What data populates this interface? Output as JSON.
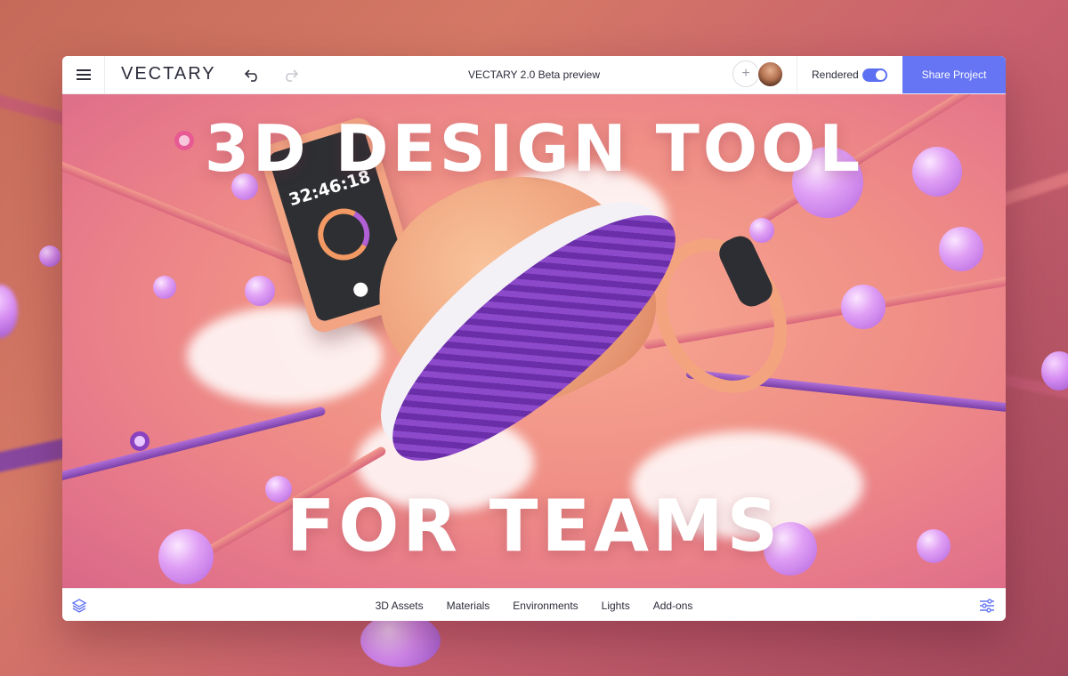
{
  "app": {
    "logo": "VECTARY",
    "title": "VECTARY 2.0 Beta preview"
  },
  "topbar": {
    "rendered_label": "Rendered",
    "rendered_on": true,
    "share_label": "Share Project",
    "add_user_symbol": "+"
  },
  "canvas": {
    "headline_top": "3D DESIGN TOOL",
    "headline_bottom": "FOR TEAMS",
    "phone_time": "32:46:18"
  },
  "bottombar": {
    "tabs": [
      "3D Assets",
      "Materials",
      "Environments",
      "Lights",
      "Add-ons"
    ]
  },
  "colors": {
    "accent": "#6575f4",
    "background": "#d57866"
  },
  "icons": {
    "menu": "hamburger-menu-icon",
    "undo": "undo-icon",
    "redo": "redo-icon",
    "layers": "layers-icon",
    "settings": "sliders-icon"
  }
}
